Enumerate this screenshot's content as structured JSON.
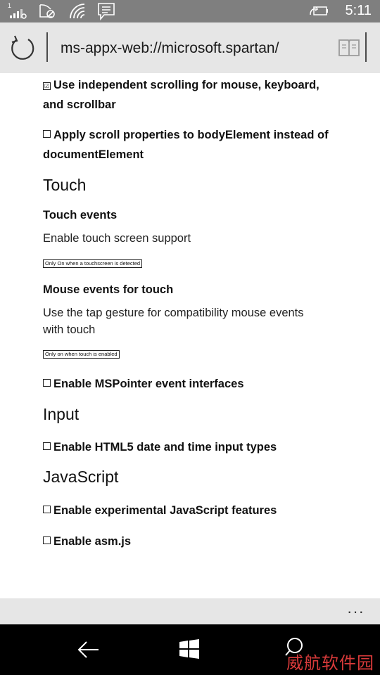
{
  "status_bar": {
    "signal_badge": "1",
    "time": "5:11",
    "icons": [
      "signal-icon",
      "rotation-lock-icon",
      "wifi-icon",
      "notification-icon",
      "battery-saver-icon"
    ]
  },
  "address_bar": {
    "url": "ms-appx-web://microsoft.spartan/",
    "icons": [
      "refresh-icon",
      "reading-view-icon"
    ]
  },
  "settings": {
    "scroll_independent": {
      "label": "Use independent scrolling for mouse, keyboard, and scrollbar",
      "checked": true,
      "mark": "☑"
    },
    "scroll_body": {
      "label": "Apply scroll properties to bodyElement instead of documentElement",
      "checked": false,
      "mark": ""
    },
    "touch": {
      "title": "Touch",
      "touch_events": {
        "title": "Touch events",
        "description": "Enable touch screen support",
        "selected": "Only On when a touchscreen is detected"
      },
      "mouse_events": {
        "title": "Mouse events for touch",
        "description": "Use the tap gesture for compatibility mouse events with touch",
        "selected": "Only on when touch is enabled"
      },
      "mspointer": {
        "label": "Enable MSPointer event interfaces",
        "checked": false
      }
    },
    "input": {
      "title": "Input",
      "html5_date": {
        "label": "Enable HTML5 date and time input types",
        "checked": false
      }
    },
    "javascript": {
      "title": "JavaScript",
      "experimental": {
        "label": "Enable experimental JavaScript features",
        "checked": false
      },
      "asmjs": {
        "label": "Enable asm.js",
        "checked": false
      }
    }
  },
  "app_bar": {
    "more": "···"
  },
  "nav_bar": {
    "icons": [
      "back-icon",
      "windows-start-icon",
      "search-icon"
    ],
    "watermark": "威航软件园"
  }
}
